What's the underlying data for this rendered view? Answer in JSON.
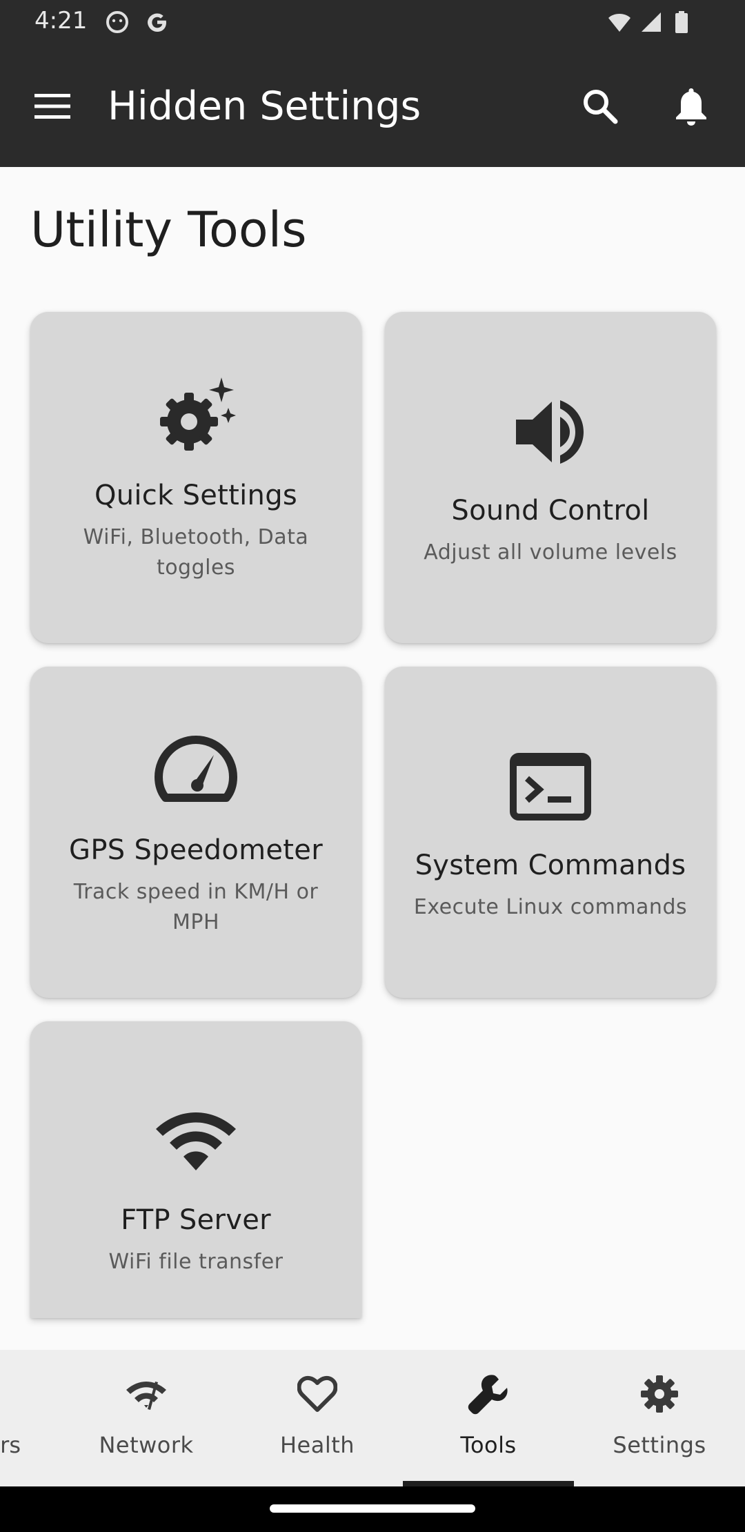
{
  "status_bar": {
    "time": "4:21",
    "icons": [
      "record-icon",
      "google-icon",
      "wifi-icon",
      "signal-icon",
      "battery-icon"
    ]
  },
  "app_bar": {
    "title": "Hidden Settings",
    "icons": [
      "menu-icon",
      "search-icon",
      "bell-icon"
    ],
    "background": "#2b2b2b"
  },
  "page": {
    "title": "Utility Tools"
  },
  "cards": [
    {
      "id": "quick-settings",
      "icon": "settings-sparkle-icon",
      "title": "Quick Settings",
      "subtitle": "WiFi, Bluetooth, Data toggles"
    },
    {
      "id": "sound-control",
      "icon": "volume-icon",
      "title": "Sound Control",
      "subtitle": "Adjust all volume levels"
    },
    {
      "id": "gps-speedometer",
      "icon": "speedometer-icon",
      "title": "GPS Speedometer",
      "subtitle": "Track speed in KM/H or MPH"
    },
    {
      "id": "system-commands",
      "icon": "terminal-icon",
      "title": "System Commands",
      "subtitle": "Execute Linux commands"
    },
    {
      "id": "ftp-server",
      "icon": "wifi-icon",
      "title": "FTP Server",
      "subtitle": "WiFi file transfer"
    }
  ],
  "bottom_nav": {
    "partial_label": "rs",
    "items": [
      {
        "label": "Network",
        "icon": "network-icon"
      },
      {
        "label": "Health",
        "icon": "heart-icon"
      },
      {
        "label": "Tools",
        "icon": "wrench-icon",
        "active": true
      },
      {
        "label": "Settings",
        "icon": "gear-icon"
      }
    ]
  },
  "colors": {
    "card_background": "#d7d7d7",
    "page_background": "#fafafa",
    "nav_background": "#eeeeee",
    "text_primary": "#1f1f1f",
    "text_secondary": "#5a5a5a"
  }
}
